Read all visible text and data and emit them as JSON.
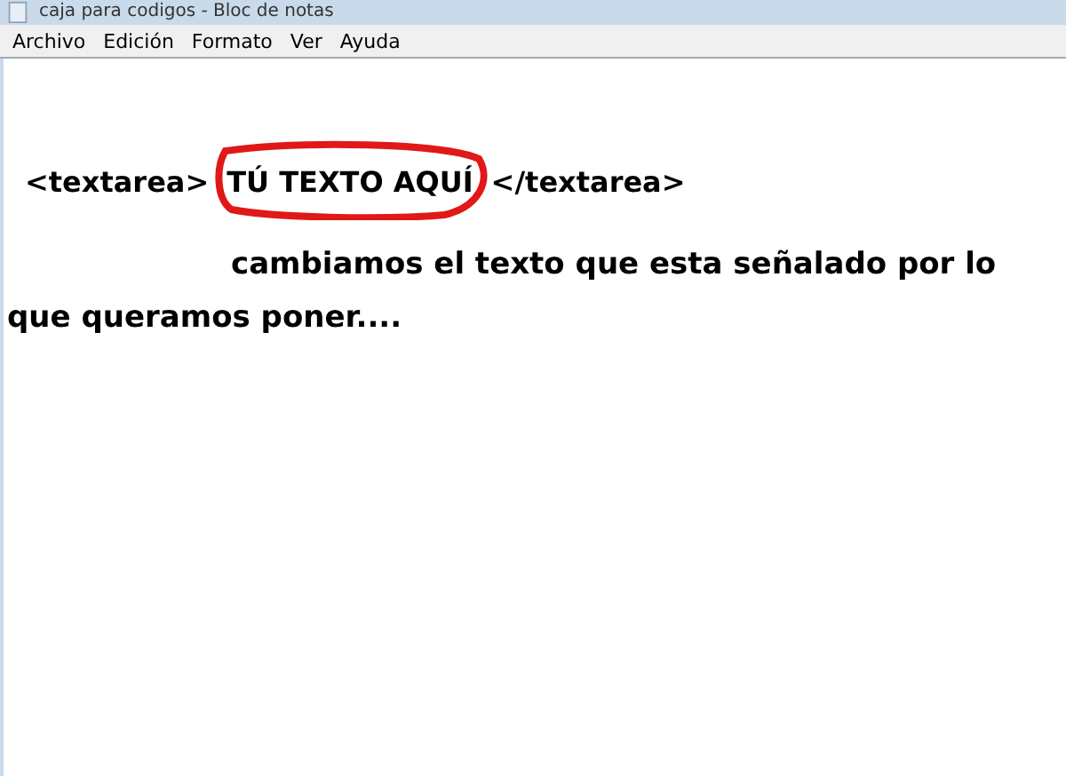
{
  "window": {
    "title": "caja para codigos - Bloc de notas"
  },
  "menu": [
    "Archivo",
    "Edición",
    "Formato",
    "Ver",
    "Ayuda"
  ],
  "document": {
    "code_open": "<textarea>",
    "code_value": "TÚ TEXTO AQUÍ",
    "code_close": "</textarea>",
    "note": "cambiamos el texto que esta señalado por lo que queramos poner...."
  }
}
